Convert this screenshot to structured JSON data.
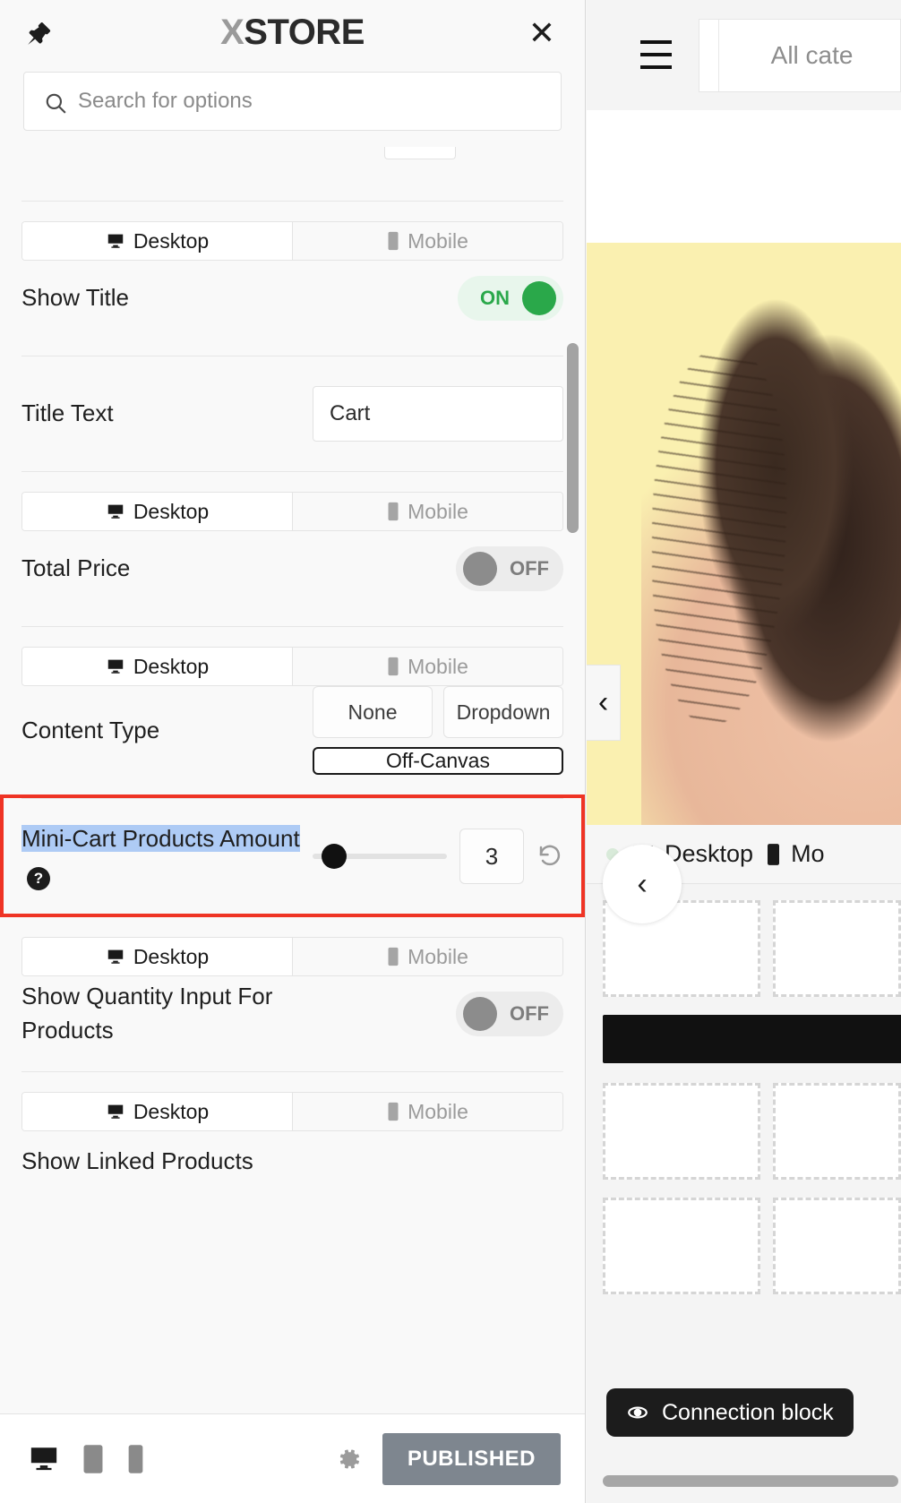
{
  "panel": {
    "brand_x": "X",
    "brand_rest": "STORE",
    "pin_icon": "pin-icon",
    "close_label": "✕",
    "search": {
      "placeholder": "Search for options",
      "value": ""
    },
    "device_tabs": {
      "desktop": "Desktop",
      "mobile": "Mobile"
    },
    "rows": [
      {
        "label": "Show Title",
        "toggle_state": "ON"
      },
      {
        "label": "Title Text",
        "value": "Cart"
      },
      {
        "label": "Total Price",
        "toggle_state": "OFF"
      },
      {
        "label": "Content Type",
        "options": [
          "None",
          "Dropdown",
          "Off-Canvas"
        ],
        "selected": "Off-Canvas"
      },
      {
        "label": "Mini-Cart Products Amount",
        "value": "3",
        "help": "?"
      },
      {
        "label": "Show Quantity Input For Products",
        "toggle_state": "OFF"
      },
      {
        "label": "Show Linked Products"
      }
    ],
    "bottom_bar": {
      "device_icons": [
        "desktop-icon",
        "tablet-icon",
        "mobile-icon"
      ],
      "settings_icon": "gear-icon",
      "publish_label": "PUBLISHED"
    }
  },
  "preview": {
    "menu_icon": "hamburger-menu-icon",
    "category_select": "All cate",
    "prev_arrow": "‹",
    "collapse_arrow": "‹",
    "device_bar": {
      "desktop": "Desktop",
      "mobile": "Mo"
    },
    "tooltip": {
      "icon": "connection-icon",
      "label": "Connection block"
    }
  },
  "colors": {
    "accent_red": "#ef3425",
    "toggle_on": "#2aa84a",
    "toggle_off": "#8c8c8c",
    "publish_bg": "#7e868f",
    "selection_highlight": "#aecbf5",
    "hero_bg": "#faf0b0"
  }
}
